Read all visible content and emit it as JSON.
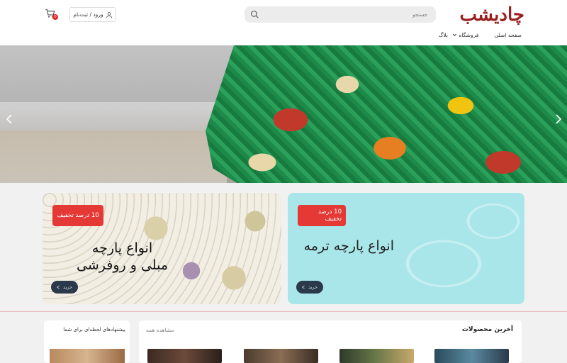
{
  "header": {
    "logo_text": "چادیشب",
    "search_placeholder": "جستجو",
    "login_label": "ورود / ثبت‌نام",
    "cart_count": "0"
  },
  "nav": {
    "items": [
      "صفحه اصلی",
      "فروشگاه",
      "بلاگ"
    ]
  },
  "banners": {
    "left": {
      "discount": "10 درصد تخفیف",
      "title_line1": "انواع پارچه",
      "title_line2": "مبلی و روفرشی",
      "button": "خرید"
    },
    "right": {
      "discount": "10 درصد تخفیف",
      "title": "انواع پارچه ترمه",
      "button": "خرید"
    }
  },
  "sections": {
    "suggestions_title": "پیشنهادهای لحظه‌ای برای شما",
    "latest_title": "آخرین محصولات",
    "see_all": "مشاهده همه"
  },
  "colors": {
    "accent_red": "#e53935",
    "logo": "#9a1f1f",
    "button_dark": "#2b3a4a"
  }
}
